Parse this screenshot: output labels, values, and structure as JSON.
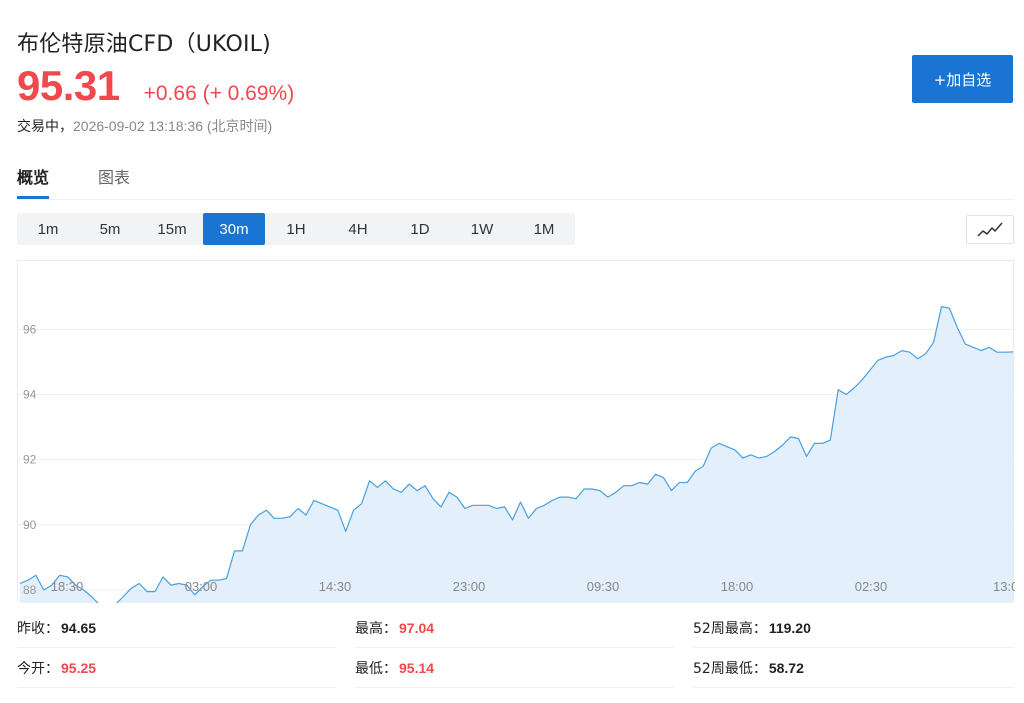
{
  "header": {
    "title": "布伦特原油CFD（UKOIL)",
    "price": "95.31",
    "change": "+0.66 (+ 0.69%)",
    "status_live": "交易中，",
    "status_time": "2026-09-02 13:18:36 (北京时间)",
    "add_button": "+加自选"
  },
  "tabs": [
    {
      "label": "概览",
      "active": true
    },
    {
      "label": "图表",
      "active": false
    }
  ],
  "periods": [
    {
      "label": "1m",
      "active": false
    },
    {
      "label": "5m",
      "active": false
    },
    {
      "label": "15m",
      "active": false
    },
    {
      "label": "30m",
      "active": true
    },
    {
      "label": "1H",
      "active": false
    },
    {
      "label": "4H",
      "active": false
    },
    {
      "label": "1D",
      "active": false
    },
    {
      "label": "1W",
      "active": false
    },
    {
      "label": "1M",
      "active": false
    }
  ],
  "chart_type_icon": "line-chart-icon",
  "colors": {
    "up": "#f0484d",
    "accent": "#1a74d4",
    "line": "#4a9fe0",
    "fill": "#deedfb"
  },
  "chart_data": {
    "type": "area",
    "ylim": [
      87.6,
      98.1
    ],
    "yticks": [
      88,
      90,
      92,
      94,
      96
    ],
    "xtick_labels": [
      "18:30",
      "03:00",
      "14:30",
      "23:00",
      "09:30",
      "18:00",
      "02:30",
      "13:0"
    ],
    "grid": true,
    "values": [
      88.2,
      88.3,
      88.45,
      88.0,
      88.15,
      88.45,
      88.4,
      88.15,
      88.0,
      87.8,
      87.55,
      87.5,
      87.55,
      87.8,
      88.05,
      88.2,
      87.95,
      87.95,
      88.4,
      88.15,
      88.2,
      88.15,
      87.85,
      88.1,
      88.3,
      88.3,
      88.35,
      89.2,
      89.2,
      90.0,
      90.3,
      90.45,
      90.2,
      90.2,
      90.25,
      90.5,
      90.3,
      90.75,
      90.65,
      90.55,
      90.45,
      89.8,
      90.45,
      90.65,
      91.35,
      91.15,
      91.35,
      91.1,
      91.0,
      91.25,
      91.05,
      91.2,
      90.8,
      90.55,
      91.0,
      90.85,
      90.5,
      90.6,
      90.6,
      90.6,
      90.5,
      90.55,
      90.15,
      90.7,
      90.2,
      90.5,
      90.6,
      90.75,
      90.85,
      90.85,
      90.8,
      91.1,
      91.1,
      91.05,
      90.85,
      91.0,
      91.2,
      91.2,
      91.3,
      91.25,
      91.55,
      91.45,
      91.05,
      91.3,
      91.3,
      91.65,
      91.8,
      92.35,
      92.5,
      92.4,
      92.3,
      92.05,
      92.15,
      92.05,
      92.1,
      92.25,
      92.45,
      92.7,
      92.65,
      92.1,
      92.5,
      92.5,
      92.6,
      94.15,
      94.0,
      94.2,
      94.45,
      94.75,
      95.05,
      95.15,
      95.2,
      95.35,
      95.3,
      95.1,
      95.25,
      95.6,
      96.7,
      96.65,
      96.05,
      95.55,
      95.45,
      95.35,
      95.45,
      95.3,
      95.3,
      95.31
    ]
  },
  "stats": [
    [
      {
        "label": "昨收：",
        "value": "94.65",
        "red": false
      },
      {
        "label": "最高：",
        "value": "97.04",
        "red": true
      },
      {
        "label": "52周最高：",
        "value": "119.20",
        "red": false
      }
    ],
    [
      {
        "label": "今开：",
        "value": "95.25",
        "red": true
      },
      {
        "label": "最低：",
        "value": "95.14",
        "red": true
      },
      {
        "label": "52周最低：",
        "value": "58.72",
        "red": false
      }
    ]
  ]
}
